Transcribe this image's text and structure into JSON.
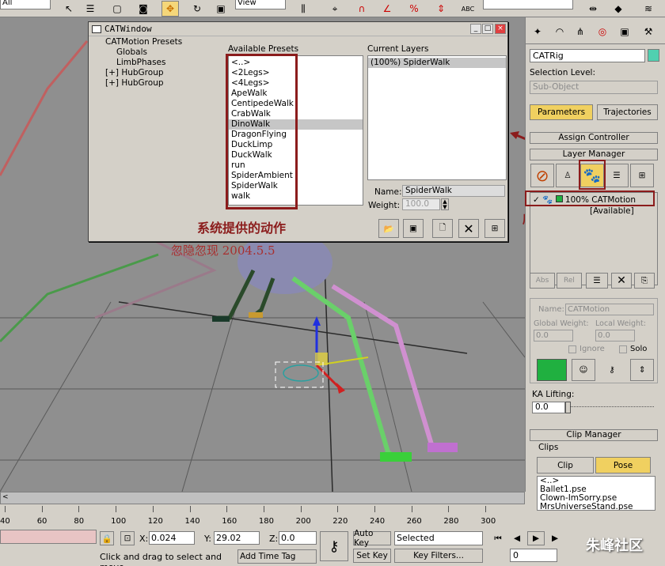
{
  "toolbar": {
    "filter_value": "All",
    "view_label": "View",
    "abc_label": "ABC"
  },
  "cat_window": {
    "title": "CATWindow",
    "tree": [
      {
        "label": "CATMotion Presets",
        "indent": 20
      },
      {
        "label": "Globals",
        "indent": 34
      },
      {
        "label": "LimbPhases",
        "indent": 34
      },
      {
        "label": "[+] HubGroup",
        "indent": 20
      },
      {
        "label": "[+] HubGroup",
        "indent": 20
      }
    ],
    "available_title": "Available Presets",
    "presets": [
      "<..>",
      "<2Legs>",
      "<4Legs>",
      "ApeWalk",
      "CentipedeWalk",
      "CrabWalk",
      "DinoWalk",
      "DragonFlying",
      "DuckLimp",
      "DuckWalk",
      "run",
      "SpiderAmbient",
      "SpiderWalk",
      "walk"
    ],
    "selected_preset": "DinoWalk",
    "current_title": "Current Layers",
    "current_layers": [
      "(100%)  SpiderWalk"
    ],
    "name_label": "Name:",
    "name_value": "SpiderWalk",
    "weight_label": "Weight:",
    "weight_value": "100.0"
  },
  "annotations": {
    "system_actions": "系统提供的动作",
    "signature": "忽隐忽现 2004.5.5",
    "base_layer": "底层"
  },
  "right_panel": {
    "object_name": "CATRig",
    "accent_color": "#00c8a0",
    "selection_level_label": "Selection Level:",
    "sub_object_label": "Sub-Object",
    "parameters_tab": "Parameters",
    "trajectories_tab": "Trajectories",
    "assign_controller": "Assign Controller",
    "layer_manager": "Layer Manager",
    "layer_item": "100% CATMotion",
    "layer_sub": "[Available]",
    "abs_label": "Abs",
    "rel_label": "Rel",
    "name_label": "Name:",
    "name_value": "CATMotion",
    "global_weight_label": "Global Weight:",
    "local_weight_label": "Local Weight:",
    "global_weight": "0.0",
    "local_weight": "0.0",
    "ignore_label": "Ignore",
    "solo_label": "Solo",
    "ka_lifting_label": "KA Lifting:",
    "ka_lifting_value": "0.0",
    "clip_manager": "Clip Manager",
    "clips_label": "Clips",
    "clip_button": "Clip",
    "pose_button": "Pose",
    "clip_files": [
      "<..>",
      "Ballet1.pse",
      "Clown-ImSorry.pse",
      "MrsUniverseStand.pse"
    ]
  },
  "timeline": {
    "ticks": [
      "40",
      "60",
      "80",
      "100",
      "120",
      "140",
      "160",
      "180",
      "200",
      "220",
      "240",
      "260",
      "280",
      "300"
    ]
  },
  "status": {
    "x_label": "X:",
    "x_value": "0.024",
    "y_label": "Y:",
    "y_value": "29.02",
    "z_label": "Z:",
    "z_value": "0.0",
    "auto_key": "Auto Key",
    "selected_value": "Selected",
    "set_key": "Set Key",
    "key_filters": "Key Filters...",
    "prompt": "Click and drag to select and move",
    "add_time_tag": "Add Time Tag",
    "frame_value": "0",
    "watermark": "朱峰社区"
  }
}
